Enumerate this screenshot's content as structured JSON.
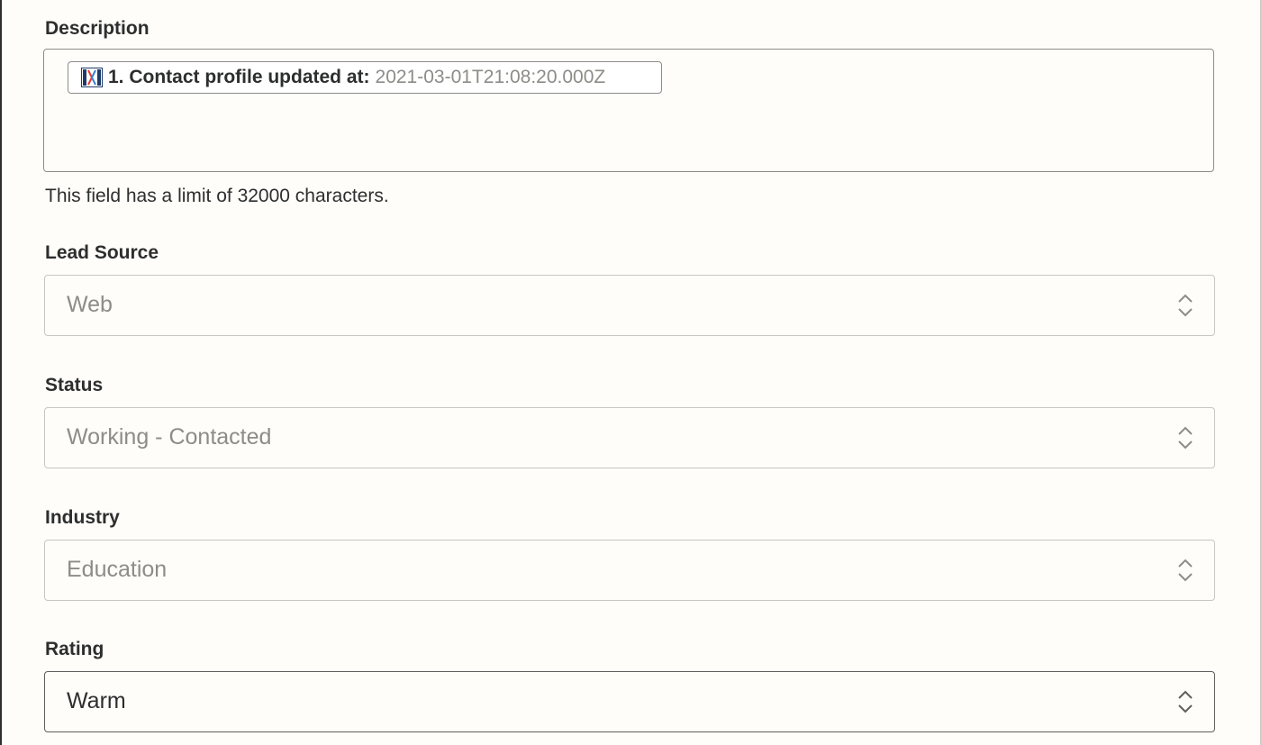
{
  "description": {
    "label": "Description",
    "pill": {
      "icon": "app-logo-icon",
      "label": "1. Contact profile updated at:",
      "value": "2021-03-01T21:08:20.000Z"
    },
    "hint": "This field has a limit of 32000 characters."
  },
  "lead_source": {
    "label": "Lead Source",
    "value": "Web"
  },
  "status": {
    "label": "Status",
    "value": "Working - Contacted"
  },
  "industry": {
    "label": "Industry",
    "value": "Education"
  },
  "rating": {
    "label": "Rating",
    "value": "Warm"
  },
  "colors": {
    "background": "#fffdf9",
    "text": "#2d2e2e",
    "muted_text": "#8d8c88",
    "border": "#c8c6c2"
  }
}
